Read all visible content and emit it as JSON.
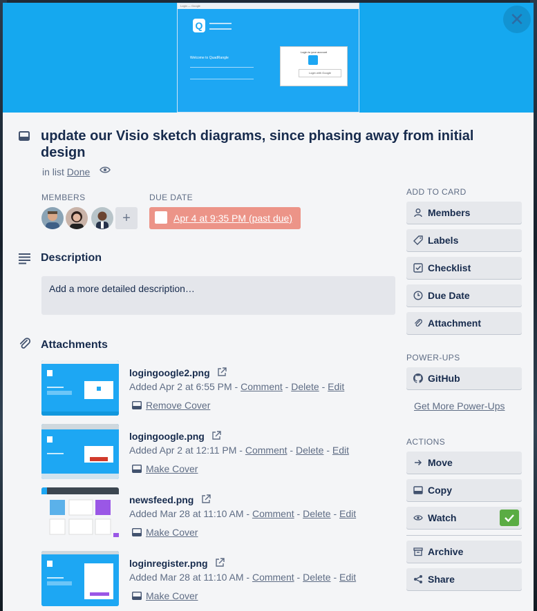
{
  "card": {
    "title": "update our Visio sketch diagrams, since phasing away from initial design",
    "in_list_prefix": "in list",
    "list_name": "Done",
    "cover_shot": {
      "tab_label": "Login — Google",
      "welcome": "Welcome to QuadRangle",
      "login_prompt": "Login to your account",
      "login_button": "Login with Google"
    }
  },
  "members": {
    "label": "MEMBERS",
    "add_label": "+"
  },
  "due": {
    "label": "DUE DATE",
    "text": "Apr 4 at 9:35 PM (past due)",
    "color": "#ec9488"
  },
  "description": {
    "title": "Description",
    "placeholder": "Add a more detailed description…"
  },
  "attachments": {
    "title": "Attachments",
    "items": [
      {
        "name": "logingoogle2.png",
        "added": "Added Apr 2 at 6:55 PM - ",
        "comment": "Comment",
        "delete": "Delete",
        "edit": "Edit",
        "cover_action": "Remove Cover"
      },
      {
        "name": "logingoogle.png",
        "added": "Added Apr 2 at 12:11 PM - ",
        "comment": "Comment",
        "delete": "Delete",
        "edit": "Edit",
        "cover_action": "Make Cover"
      },
      {
        "name": "newsfeed.png",
        "added": "Added Mar 28 at 11:10 AM - ",
        "comment": "Comment",
        "delete": "Delete",
        "edit": "Edit",
        "cover_action": "Make Cover"
      },
      {
        "name": "loginregister.png",
        "added": "Added Mar 28 at 11:10 AM - ",
        "comment": "Comment",
        "delete": "Delete",
        "edit": "Edit",
        "cover_action": "Make Cover"
      }
    ],
    "separator": " - "
  },
  "sidebar": {
    "add_to_card": {
      "heading": "ADD TO CARD",
      "items": [
        "Members",
        "Labels",
        "Checklist",
        "Due Date",
        "Attachment"
      ]
    },
    "power_ups": {
      "heading": "POWER-UPS",
      "github": "GitHub",
      "more_link": "Get More Power-Ups"
    },
    "actions": {
      "heading": "ACTIONS",
      "items": [
        "Move",
        "Copy",
        "Watch",
        "Archive",
        "Share"
      ],
      "watch_checked": true
    }
  },
  "colors": {
    "cover": "#15a8ef",
    "watch_check": "#5aac44"
  },
  "icons": [
    "card-icon",
    "eye-icon",
    "description-icon",
    "paperclip-icon",
    "external-link-icon",
    "cover-icon",
    "person-icon",
    "tag-icon",
    "checklist-icon",
    "clock-icon",
    "github-icon",
    "arrow-right-icon",
    "share-icon",
    "archive-icon",
    "close-icon",
    "check-icon"
  ]
}
